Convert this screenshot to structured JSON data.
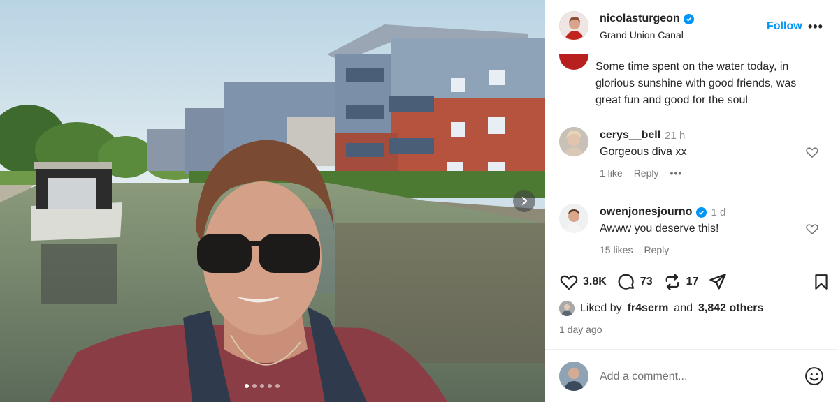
{
  "post": {
    "username": "nicolasturgeon",
    "verified": true,
    "location": "Grand Union Canal",
    "follow_label": "Follow",
    "more_label": "•••",
    "caption": "Some time spent on the water today, in glorious sunshine with good friends, was great fun and good for the soul",
    "carousel": {
      "slide_count": 5,
      "active_index": 0
    }
  },
  "comments": [
    {
      "username": "cerys__bell",
      "verified": false,
      "time": "21 h",
      "text": "Gorgeous diva xx",
      "likes": "1 like",
      "reply_label": "Reply",
      "more_label": "•••"
    },
    {
      "username": "owenjonesjourno",
      "verified": true,
      "time": "1 d",
      "text": "Awww you deserve this!",
      "likes": "15 likes",
      "reply_label": "Reply"
    }
  ],
  "actions": {
    "like_count": "3.8K",
    "comment_count": "73",
    "repost_count": "17"
  },
  "liked_by": {
    "prefix": "Liked by",
    "user": "fr4serm",
    "and": "and",
    "others": "3,842 others"
  },
  "posted_ago": "1 day ago",
  "add_comment": {
    "placeholder": "Add a comment..."
  },
  "icons": {
    "like": "heart-icon",
    "comment": "comment-icon",
    "repost": "repost-icon",
    "share": "share-icon",
    "save": "bookmark-icon",
    "emoji": "emoji-icon",
    "next": "chevron-right-icon",
    "verified": "verified-badge-icon"
  },
  "colors": {
    "accent": "#0095f6",
    "text": "#262626",
    "muted": "#737373"
  }
}
